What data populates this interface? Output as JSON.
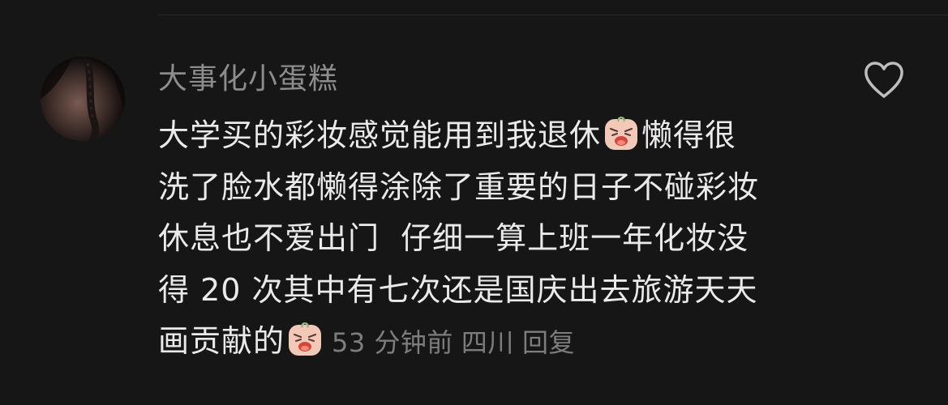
{
  "comment": {
    "username": "大事化小蛋糕",
    "lines": [
      {
        "before": "大学买的彩妆感觉能用到我退休",
        "emoji": "crying-face-emoji",
        "after": "懒得很"
      },
      {
        "text": "洗了脸水都懒得涂除了重要的日子不碰彩妆"
      },
      {
        "text": "休息也不爱出门  仔细一算上班一年化妆没"
      },
      {
        "text": "得 20 次其中有七次还是国庆出去旅游天天"
      },
      {
        "before": "画贡献的",
        "emoji": "crying-face-emoji"
      }
    ],
    "time": "53 分钟前",
    "location": "四川",
    "reply_label": "回复",
    "like_icon": "heart-outline-icon"
  },
  "colors": {
    "background": "#161616",
    "username": "#8c8c8c",
    "text": "#eaeaea",
    "meta": "#7d7d7d"
  }
}
